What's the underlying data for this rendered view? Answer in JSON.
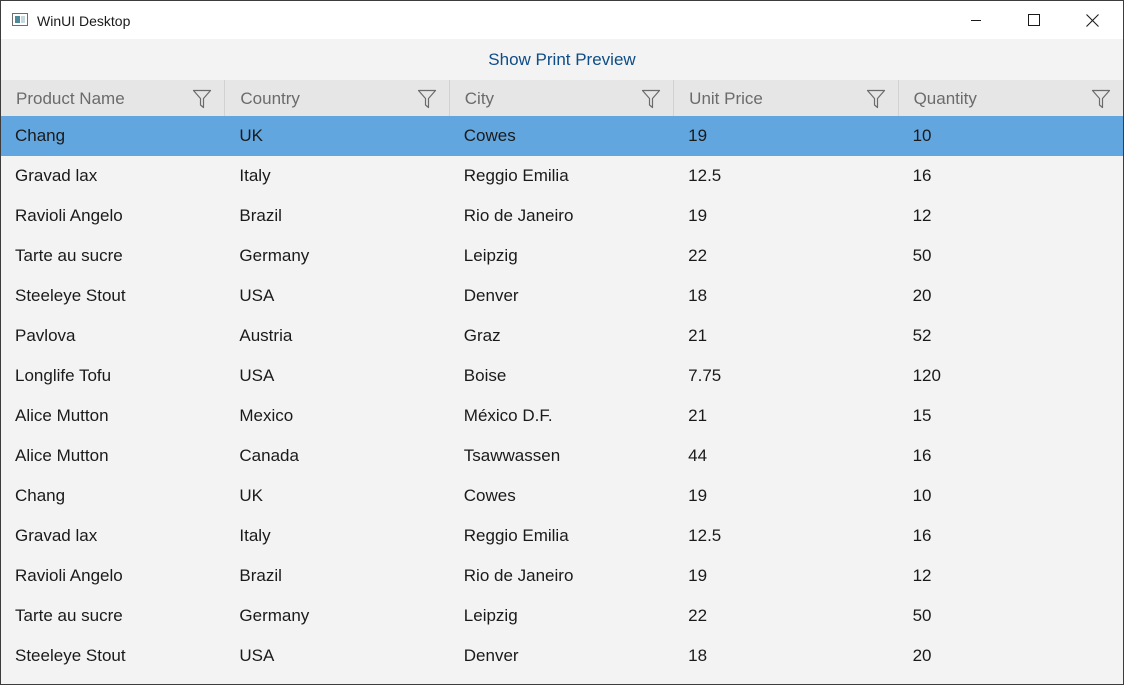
{
  "window": {
    "title": "WinUI Desktop"
  },
  "toolbar": {
    "print_preview_label": "Show Print Preview"
  },
  "grid": {
    "columns": [
      "Product Name",
      "Country",
      "City",
      "Unit Price",
      "Quantity"
    ],
    "selected_row_index": 0,
    "rows": [
      [
        "Chang",
        "UK",
        "Cowes",
        "19",
        "10"
      ],
      [
        "Gravad lax",
        "Italy",
        "Reggio Emilia",
        "12.5",
        "16"
      ],
      [
        "Ravioli Angelo",
        "Brazil",
        "Rio de Janeiro",
        "19",
        "12"
      ],
      [
        "Tarte au sucre",
        "Germany",
        "Leipzig",
        "22",
        "50"
      ],
      [
        "Steeleye Stout",
        "USA",
        "Denver",
        "18",
        "20"
      ],
      [
        "Pavlova",
        "Austria",
        "Graz",
        "21",
        "52"
      ],
      [
        "Longlife Tofu",
        "USA",
        "Boise",
        "7.75",
        "120"
      ],
      [
        "Alice Mutton",
        "Mexico",
        "México D.F.",
        "21",
        "15"
      ],
      [
        "Alice Mutton",
        "Canada",
        "Tsawwassen",
        "44",
        "16"
      ],
      [
        "Chang",
        "UK",
        "Cowes",
        "19",
        "10"
      ],
      [
        "Gravad lax",
        "Italy",
        "Reggio Emilia",
        "12.5",
        "16"
      ],
      [
        "Ravioli Angelo",
        "Brazil",
        "Rio de Janeiro",
        "19",
        "12"
      ],
      [
        "Tarte au sucre",
        "Germany",
        "Leipzig",
        "22",
        "50"
      ],
      [
        "Steeleye Stout",
        "USA",
        "Denver",
        "18",
        "20"
      ]
    ]
  },
  "colors": {
    "selected_row": "#62a6e0",
    "header_bg": "#e6e6e6",
    "link_text": "#0e4c87"
  },
  "icons": {
    "app": "app-window-icon",
    "minimize": "minimize-icon",
    "maximize": "maximize-icon",
    "close": "close-icon",
    "filter": "filter-icon"
  }
}
